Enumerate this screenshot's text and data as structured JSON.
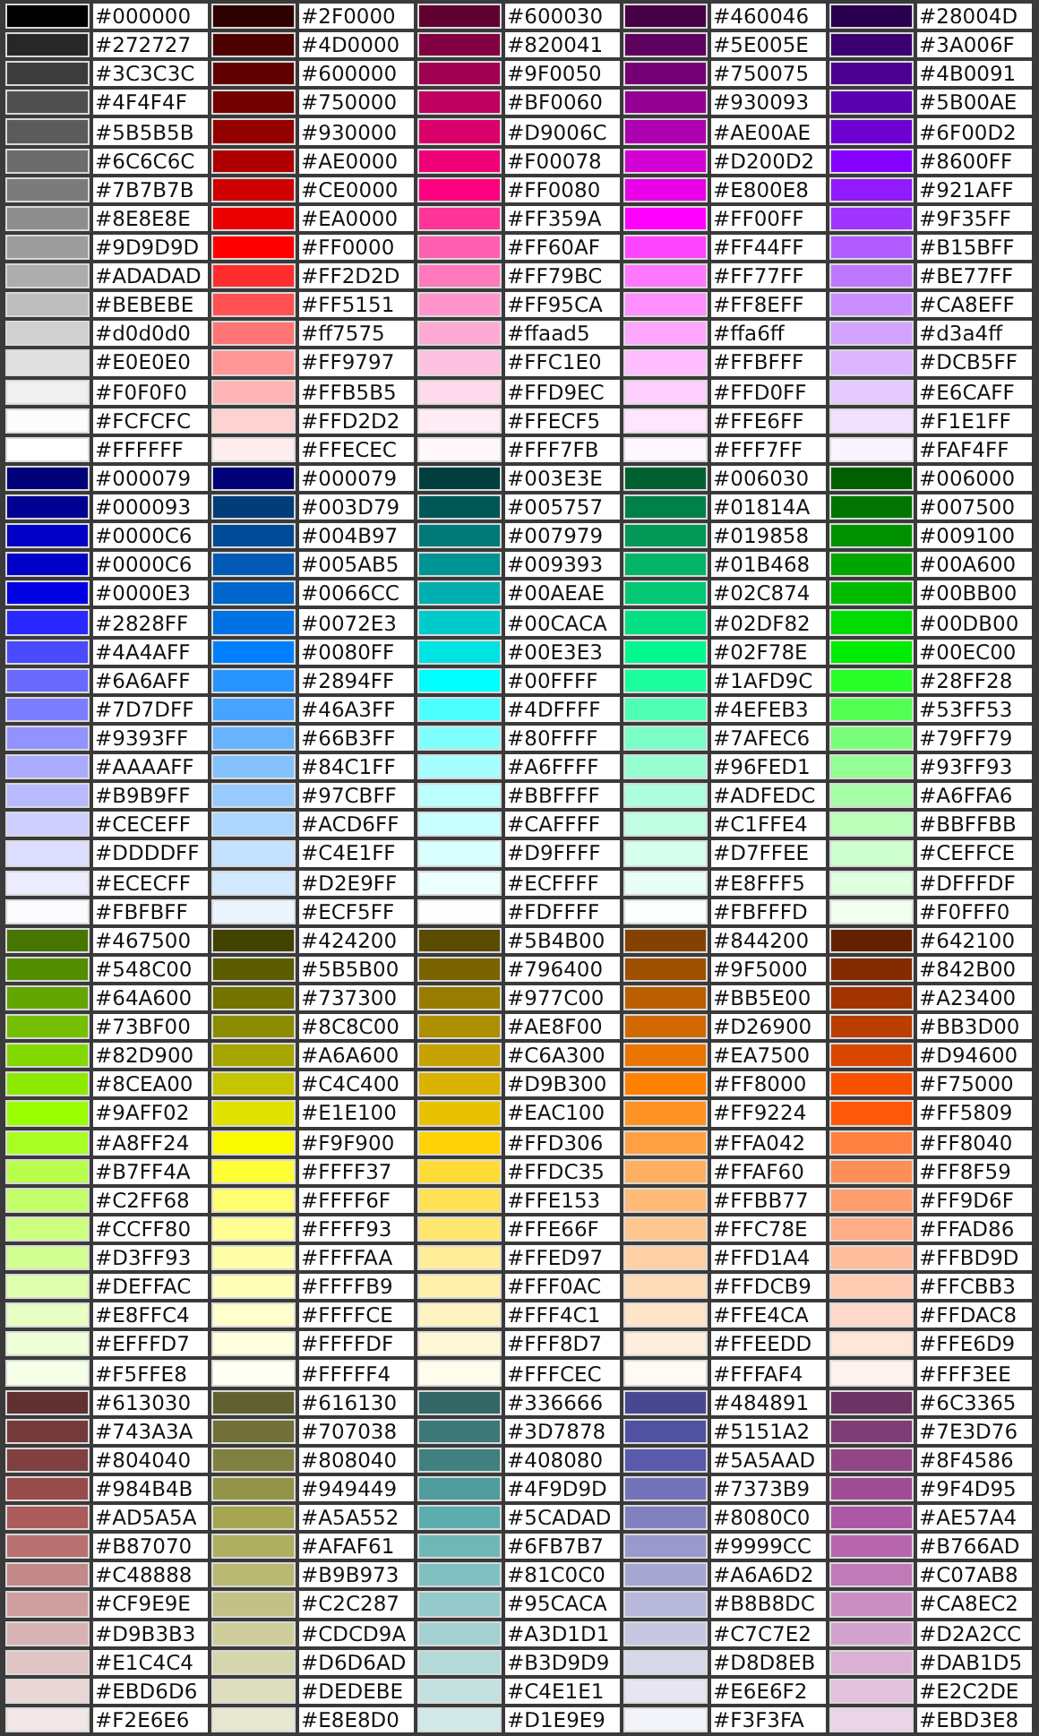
{
  "groups": [
    {
      "rows": [
        [
          {
            "code": "#000000",
            "color": "#000000"
          },
          {
            "code": "#2F0000",
            "color": "#2f0000"
          },
          {
            "code": "#600030",
            "color": "#600030"
          },
          {
            "code": "#460046",
            "color": "#460046"
          },
          {
            "code": "#28004D",
            "color": "#28004d"
          }
        ],
        [
          {
            "code": "#272727",
            "color": "#272727"
          },
          {
            "code": "#4D0000",
            "color": "#4d0000"
          },
          {
            "code": "#820041",
            "color": "#820041"
          },
          {
            "code": "#5E005E",
            "color": "#5e005e"
          },
          {
            "code": "#3A006F",
            "color": "#3a006f"
          }
        ],
        [
          {
            "code": "#3C3C3C",
            "color": "#3c3c3c"
          },
          {
            "code": "#600000",
            "color": "#600000"
          },
          {
            "code": "#9F0050",
            "color": "#9f0050"
          },
          {
            "code": "#750075",
            "color": "#750075"
          },
          {
            "code": "#4B0091",
            "color": "#4b0091"
          }
        ],
        [
          {
            "code": "#4F4F4F",
            "color": "#4f4f4f"
          },
          {
            "code": "#750000",
            "color": "#750000"
          },
          {
            "code": "#BF0060",
            "color": "#bf0060"
          },
          {
            "code": "#930093",
            "color": "#930093"
          },
          {
            "code": "#5B00AE",
            "color": "#5b00ae"
          }
        ],
        [
          {
            "code": "#5B5B5B",
            "color": "#5b5b5b"
          },
          {
            "code": "#930000",
            "color": "#930000"
          },
          {
            "code": "#D9006C",
            "color": "#d9006c"
          },
          {
            "code": "#AE00AE",
            "color": "#ae00ae"
          },
          {
            "code": "#6F00D2",
            "color": "#6f00d2"
          }
        ],
        [
          {
            "code": "#6C6C6C",
            "color": "#6c6c6c"
          },
          {
            "code": "#AE0000",
            "color": "#ae0000"
          },
          {
            "code": "#F00078",
            "color": "#f00078"
          },
          {
            "code": "#D200D2",
            "color": "#d200d2"
          },
          {
            "code": "#8600FF",
            "color": "#8600ff"
          }
        ],
        [
          {
            "code": "#7B7B7B",
            "color": "#7b7b7b"
          },
          {
            "code": "#CE0000",
            "color": "#ce0000"
          },
          {
            "code": "#FF0080",
            "color": "#ff0080"
          },
          {
            "code": "#E800E8",
            "color": "#e800e8"
          },
          {
            "code": "#921AFF",
            "color": "#921aff"
          }
        ],
        [
          {
            "code": "#8E8E8E",
            "color": "#8e8e8e"
          },
          {
            "code": "#EA0000",
            "color": "#ea0000"
          },
          {
            "code": "#FF359A",
            "color": "#ff359a"
          },
          {
            "code": "#FF00FF",
            "color": "#ff00ff"
          },
          {
            "code": "#9F35FF",
            "color": "#9f35ff"
          }
        ],
        [
          {
            "code": "#9D9D9D",
            "color": "#9d9d9d"
          },
          {
            "code": "#FF0000",
            "color": "#ff0000"
          },
          {
            "code": "#FF60AF",
            "color": "#ff60af"
          },
          {
            "code": "#FF44FF",
            "color": "#ff44ff"
          },
          {
            "code": "#B15BFF",
            "color": "#b15bff"
          }
        ],
        [
          {
            "code": "#ADADAD",
            "color": "#adadad"
          },
          {
            "code": "#FF2D2D",
            "color": "#ff2d2d"
          },
          {
            "code": "#FF79BC",
            "color": "#ff79bc"
          },
          {
            "code": "#FF77FF",
            "color": "#ff77ff"
          },
          {
            "code": "#BE77FF",
            "color": "#be77ff"
          }
        ],
        [
          {
            "code": "#BEBEBE",
            "color": "#bebebe"
          },
          {
            "code": "#FF5151",
            "color": "#ff5151"
          },
          {
            "code": "#FF95CA",
            "color": "#ff95ca"
          },
          {
            "code": "#FF8EFF",
            "color": "#ff8eff"
          },
          {
            "code": "#CA8EFF",
            "color": "#ca8eff"
          }
        ],
        [
          {
            "code": "#d0d0d0",
            "color": "#d0d0d0"
          },
          {
            "code": "#ff7575",
            "color": "#ff7575"
          },
          {
            "code": "#ffaad5",
            "color": "#ffaad5"
          },
          {
            "code": "#ffa6ff",
            "color": "#ffa6ff"
          },
          {
            "code": "#d3a4ff",
            "color": "#d3a4ff"
          }
        ],
        [
          {
            "code": "#E0E0E0",
            "color": "#e0e0e0"
          },
          {
            "code": "#FF9797",
            "color": "#ff9797"
          },
          {
            "code": "#FFC1E0",
            "color": "#ffc1e0"
          },
          {
            "code": "#FFBFFF",
            "color": "#ffbfff"
          },
          {
            "code": "#DCB5FF",
            "color": "#dcb5ff"
          }
        ],
        [
          {
            "code": "#F0F0F0",
            "color": "#f0f0f0"
          },
          {
            "code": "#FFB5B5",
            "color": "#ffb5b5"
          },
          {
            "code": "#FFD9EC",
            "color": "#ffd9ec"
          },
          {
            "code": "#FFD0FF",
            "color": "#ffd0ff"
          },
          {
            "code": "#E6CAFF",
            "color": "#e6caff"
          }
        ],
        [
          {
            "code": "#FCFCFC",
            "color": "#fcfcfc"
          },
          {
            "code": "#FFD2D2",
            "color": "#ffd2d2"
          },
          {
            "code": "#FFECF5",
            "color": "#ffecf5"
          },
          {
            "code": "#FFE6FF",
            "color": "#ffe6ff"
          },
          {
            "code": "#F1E1FF",
            "color": "#f1e1ff"
          }
        ],
        [
          {
            "code": "#FFFFFF",
            "color": "#ffffff"
          },
          {
            "code": "#FFECEC",
            "color": "#ffecec"
          },
          {
            "code": "#FFF7FB",
            "color": "#fff7fb"
          },
          {
            "code": "#FFF7FF",
            "color": "#fff7ff"
          },
          {
            "code": "#FAF4FF",
            "color": "#faf4ff"
          }
        ]
      ]
    },
    {
      "rows": [
        [
          {
            "code": "#000079",
            "color": "#000079"
          },
          {
            "code": "#000079",
            "color": "#000079"
          },
          {
            "code": "#003E3E",
            "color": "#003e3e"
          },
          {
            "code": "#006030",
            "color": "#006030"
          },
          {
            "code": "#006000",
            "color": "#006000"
          }
        ],
        [
          {
            "code": "#000093",
            "color": "#000093"
          },
          {
            "code": "#003D79",
            "color": "#003d79"
          },
          {
            "code": "#005757",
            "color": "#005757"
          },
          {
            "code": "#01814A",
            "color": "#01814a"
          },
          {
            "code": "#007500",
            "color": "#007500"
          }
        ],
        [
          {
            "code": "#0000C6",
            "color": "#0000c6"
          },
          {
            "code": "#004B97",
            "color": "#004b97"
          },
          {
            "code": "#007979",
            "color": "#007979"
          },
          {
            "code": "#019858",
            "color": "#019858"
          },
          {
            "code": "#009100",
            "color": "#009100"
          }
        ],
        [
          {
            "code": "#0000C6",
            "color": "#0000c6"
          },
          {
            "code": "#005AB5",
            "color": "#005ab5"
          },
          {
            "code": "#009393",
            "color": "#009393"
          },
          {
            "code": "#01B468",
            "color": "#01b468"
          },
          {
            "code": "#00A600",
            "color": "#00a600"
          }
        ],
        [
          {
            "code": "#0000E3",
            "color": "#0000e3"
          },
          {
            "code": "#0066CC",
            "color": "#0066cc"
          },
          {
            "code": "#00AEAE",
            "color": "#00aeae"
          },
          {
            "code": "#02C874",
            "color": "#02c874"
          },
          {
            "code": "#00BB00",
            "color": "#00bb00"
          }
        ],
        [
          {
            "code": "#2828FF",
            "color": "#2828ff"
          },
          {
            "code": "#0072E3",
            "color": "#0072e3"
          },
          {
            "code": "#00CACA",
            "color": "#00caca"
          },
          {
            "code": "#02DF82",
            "color": "#02df82"
          },
          {
            "code": "#00DB00",
            "color": "#00db00"
          }
        ],
        [
          {
            "code": "#4A4AFF",
            "color": "#4a4aff"
          },
          {
            "code": "#0080FF",
            "color": "#0080ff"
          },
          {
            "code": "#00E3E3",
            "color": "#00e3e3"
          },
          {
            "code": "#02F78E",
            "color": "#02f78e"
          },
          {
            "code": "#00EC00",
            "color": "#00ec00"
          }
        ],
        [
          {
            "code": "#6A6AFF",
            "color": "#6a6aff"
          },
          {
            "code": "#2894FF",
            "color": "#2894ff"
          },
          {
            "code": "#00FFFF",
            "color": "#00ffff"
          },
          {
            "code": "#1AFD9C",
            "color": "#1afd9c"
          },
          {
            "code": "#28FF28",
            "color": "#28ff28"
          }
        ],
        [
          {
            "code": "#7D7DFF",
            "color": "#7d7dff"
          },
          {
            "code": "#46A3FF",
            "color": "#46a3ff"
          },
          {
            "code": "#4DFFFF",
            "color": "#4dffff"
          },
          {
            "code": "#4EFEB3",
            "color": "#4efeb3"
          },
          {
            "code": "#53FF53",
            "color": "#53ff53"
          }
        ],
        [
          {
            "code": "#9393FF",
            "color": "#9393ff"
          },
          {
            "code": "#66B3FF",
            "color": "#66b3ff"
          },
          {
            "code": "#80FFFF",
            "color": "#80ffff"
          },
          {
            "code": "#7AFEC6",
            "color": "#7afec6"
          },
          {
            "code": "#79FF79",
            "color": "#79ff79"
          }
        ],
        [
          {
            "code": "#AAAAFF",
            "color": "#aaaaff"
          },
          {
            "code": "#84C1FF",
            "color": "#84c1ff"
          },
          {
            "code": "#A6FFFF",
            "color": "#a6ffff"
          },
          {
            "code": "#96FED1",
            "color": "#96fed1"
          },
          {
            "code": "#93FF93",
            "color": "#93ff93"
          }
        ],
        [
          {
            "code": "#B9B9FF",
            "color": "#b9b9ff"
          },
          {
            "code": "#97CBFF",
            "color": "#97cbff"
          },
          {
            "code": "#BBFFFF",
            "color": "#bbffff"
          },
          {
            "code": "#ADFEDC",
            "color": "#adfedc"
          },
          {
            "code": "#A6FFA6",
            "color": "#a6ffa6"
          }
        ],
        [
          {
            "code": "#CECEFF",
            "color": "#ceceff"
          },
          {
            "code": "#ACD6FF",
            "color": "#acd6ff"
          },
          {
            "code": "#CAFFFF",
            "color": "#caffff"
          },
          {
            "code": "#C1FFE4",
            "color": "#c1ffe4"
          },
          {
            "code": "#BBFFBB",
            "color": "#bbffbb"
          }
        ],
        [
          {
            "code": "#DDDDFF",
            "color": "#ddddff"
          },
          {
            "code": "#C4E1FF",
            "color": "#c4e1ff"
          },
          {
            "code": "#D9FFFF",
            "color": "#d9ffff"
          },
          {
            "code": "#D7FFEE",
            "color": "#d7ffee"
          },
          {
            "code": "#CEFFCE",
            "color": "#ceffce"
          }
        ],
        [
          {
            "code": "#ECECFF",
            "color": "#ececff"
          },
          {
            "code": "#D2E9FF",
            "color": "#d2e9ff"
          },
          {
            "code": "#ECFFFF",
            "color": "#ecffff"
          },
          {
            "code": "#E8FFF5",
            "color": "#e8fff5"
          },
          {
            "code": "#DFFFDF",
            "color": "#dfffdf"
          }
        ],
        [
          {
            "code": "#FBFBFF",
            "color": "#fbfbff"
          },
          {
            "code": "#ECF5FF",
            "color": "#ecf5ff"
          },
          {
            "code": "#FDFFFF",
            "color": "#fdffff"
          },
          {
            "code": "#FBFFFD",
            "color": "#fbfffd"
          },
          {
            "code": "#F0FFF0",
            "color": "#f0fff0"
          }
        ]
      ]
    },
    {
      "rows": [
        [
          {
            "code": "#467500",
            "color": "#467500"
          },
          {
            "code": "#424200",
            "color": "#424200"
          },
          {
            "code": "#5B4B00",
            "color": "#5b4b00"
          },
          {
            "code": "#844200",
            "color": "#844200"
          },
          {
            "code": "#642100",
            "color": "#642100"
          }
        ],
        [
          {
            "code": "#548C00",
            "color": "#548c00"
          },
          {
            "code": "#5B5B00",
            "color": "#5b5b00"
          },
          {
            "code": "#796400",
            "color": "#796400"
          },
          {
            "code": "#9F5000",
            "color": "#9f5000"
          },
          {
            "code": "#842B00",
            "color": "#842b00"
          }
        ],
        [
          {
            "code": "#64A600",
            "color": "#64a600"
          },
          {
            "code": "#737300",
            "color": "#737300"
          },
          {
            "code": "#977C00",
            "color": "#977c00"
          },
          {
            "code": "#BB5E00",
            "color": "#bb5e00"
          },
          {
            "code": "#A23400",
            "color": "#a23400"
          }
        ],
        [
          {
            "code": "#73BF00",
            "color": "#73bf00"
          },
          {
            "code": "#8C8C00",
            "color": "#8c8c00"
          },
          {
            "code": "#AE8F00",
            "color": "#ae8f00"
          },
          {
            "code": "#D26900",
            "color": "#d26900"
          },
          {
            "code": "#BB3D00",
            "color": "#bb3d00"
          }
        ],
        [
          {
            "code": "#82D900",
            "color": "#82d900"
          },
          {
            "code": "#A6A600",
            "color": "#a6a600"
          },
          {
            "code": "#C6A300",
            "color": "#c6a300"
          },
          {
            "code": "#EA7500",
            "color": "#ea7500"
          },
          {
            "code": "#D94600",
            "color": "#d94600"
          }
        ],
        [
          {
            "code": "#8CEA00",
            "color": "#8cea00"
          },
          {
            "code": "#C4C400",
            "color": "#c4c400"
          },
          {
            "code": "#D9B300",
            "color": "#d9b300"
          },
          {
            "code": "#FF8000",
            "color": "#ff8000"
          },
          {
            "code": "#F75000",
            "color": "#f75000"
          }
        ],
        [
          {
            "code": "#9AFF02",
            "color": "#9aff02"
          },
          {
            "code": "#E1E100",
            "color": "#e1e100"
          },
          {
            "code": "#EAC100",
            "color": "#eac100"
          },
          {
            "code": "#FF9224",
            "color": "#ff9224"
          },
          {
            "code": "#FF5809",
            "color": "#ff5809"
          }
        ],
        [
          {
            "code": "#A8FF24",
            "color": "#a8ff24"
          },
          {
            "code": "#F9F900",
            "color": "#f9f900"
          },
          {
            "code": "#FFD306",
            "color": "#ffd306"
          },
          {
            "code": "#FFA042",
            "color": "#ffa042"
          },
          {
            "code": "#FF8040",
            "color": "#ff8040"
          }
        ],
        [
          {
            "code": "#B7FF4A",
            "color": "#b7ff4a"
          },
          {
            "code": "#FFFF37",
            "color": "#ffff37"
          },
          {
            "code": "#FFDC35",
            "color": "#ffdc35"
          },
          {
            "code": "#FFAF60",
            "color": "#ffaf60"
          },
          {
            "code": "#FF8F59",
            "color": "#ff8f59"
          }
        ],
        [
          {
            "code": "#C2FF68",
            "color": "#c2ff68"
          },
          {
            "code": "#FFFF6F",
            "color": "#ffff6f"
          },
          {
            "code": "#FFE153",
            "color": "#ffe153"
          },
          {
            "code": "#FFBB77",
            "color": "#ffbb77"
          },
          {
            "code": "#FF9D6F",
            "color": "#ff9d6f"
          }
        ],
        [
          {
            "code": "#CCFF80",
            "color": "#ccff80"
          },
          {
            "code": "#FFFF93",
            "color": "#ffff93"
          },
          {
            "code": "#FFE66F",
            "color": "#ffe66f"
          },
          {
            "code": "#FFC78E",
            "color": "#ffc78e"
          },
          {
            "code": "#FFAD86",
            "color": "#ffad86"
          }
        ],
        [
          {
            "code": "#D3FF93",
            "color": "#d3ff93"
          },
          {
            "code": "#FFFFAA",
            "color": "#ffffaa"
          },
          {
            "code": "#FFED97",
            "color": "#ffed97"
          },
          {
            "code": "#FFD1A4",
            "color": "#ffd1a4"
          },
          {
            "code": "#FFBD9D",
            "color": "#ffbd9d"
          }
        ],
        [
          {
            "code": "#DEFFAC",
            "color": "#deffac"
          },
          {
            "code": "#FFFFB9",
            "color": "#ffffb9"
          },
          {
            "code": "#FFF0AC",
            "color": "#fff0ac"
          },
          {
            "code": "#FFDCB9",
            "color": "#ffdcb9"
          },
          {
            "code": "#FFCBB3",
            "color": "#ffcbb3"
          }
        ],
        [
          {
            "code": "#E8FFC4",
            "color": "#e8ffc4"
          },
          {
            "code": "#FFFFCE",
            "color": "#ffffce"
          },
          {
            "code": "#FFF4C1",
            "color": "#fff4c1"
          },
          {
            "code": "#FFE4CA",
            "color": "#ffe4ca"
          },
          {
            "code": "#FFDAC8",
            "color": "#ffdac8"
          }
        ],
        [
          {
            "code": "#EFFFD7",
            "color": "#efffd7"
          },
          {
            "code": "#FFFFDF",
            "color": "#ffffdf"
          },
          {
            "code": "#FFF8D7",
            "color": "#fff8d7"
          },
          {
            "code": "#FFEEDD",
            "color": "#ffeedd"
          },
          {
            "code": "#FFE6D9",
            "color": "#ffe6d9"
          }
        ],
        [
          {
            "code": "#F5FFE8",
            "color": "#f5ffe8"
          },
          {
            "code": "#FFFFF4",
            "color": "#fffff4"
          },
          {
            "code": "#FFFCEC",
            "color": "#fffcec"
          },
          {
            "code": "#FFFAF4",
            "color": "#fffaf4"
          },
          {
            "code": "#FFF3EE",
            "color": "#fff3ee"
          }
        ]
      ]
    },
    {
      "rows": [
        [
          {
            "code": "#613030",
            "color": "#613030"
          },
          {
            "code": "#616130",
            "color": "#616130"
          },
          {
            "code": "#336666",
            "color": "#336666"
          },
          {
            "code": "#484891",
            "color": "#484891"
          },
          {
            "code": "#6C3365",
            "color": "#6c3365"
          }
        ],
        [
          {
            "code": "#743A3A",
            "color": "#743a3a"
          },
          {
            "code": "#707038",
            "color": "#707038"
          },
          {
            "code": "#3D7878",
            "color": "#3d7878"
          },
          {
            "code": "#5151A2",
            "color": "#5151a2"
          },
          {
            "code": "#7E3D76",
            "color": "#7e3d76"
          }
        ],
        [
          {
            "code": "#804040",
            "color": "#804040"
          },
          {
            "code": "#808040",
            "color": "#808040"
          },
          {
            "code": "#408080",
            "color": "#408080"
          },
          {
            "code": "#5A5AAD",
            "color": "#5a5aad"
          },
          {
            "code": "#8F4586",
            "color": "#8f4586"
          }
        ],
        [
          {
            "code": "#984B4B",
            "color": "#984b4b"
          },
          {
            "code": "#949449",
            "color": "#949449"
          },
          {
            "code": "#4F9D9D",
            "color": "#4f9d9d"
          },
          {
            "code": "#7373B9",
            "color": "#7373b9"
          },
          {
            "code": "#9F4D95",
            "color": "#9f4d95"
          }
        ],
        [
          {
            "code": "#AD5A5A",
            "color": "#ad5a5a"
          },
          {
            "code": "#A5A552",
            "color": "#a5a552"
          },
          {
            "code": "#5CADAD",
            "color": "#5cadad"
          },
          {
            "code": "#8080C0",
            "color": "#8080c0"
          },
          {
            "code": "#AE57A4",
            "color": "#ae57a4"
          }
        ],
        [
          {
            "code": "#B87070",
            "color": "#b87070"
          },
          {
            "code": "#AFAF61",
            "color": "#afaf61"
          },
          {
            "code": "#6FB7B7",
            "color": "#6fb7b7"
          },
          {
            "code": "#9999CC",
            "color": "#9999cc"
          },
          {
            "code": "#B766AD",
            "color": "#b766ad"
          }
        ],
        [
          {
            "code": "#C48888",
            "color": "#c48888"
          },
          {
            "code": "#B9B973",
            "color": "#b9b973"
          },
          {
            "code": "#81C0C0",
            "color": "#81c0c0"
          },
          {
            "code": "#A6A6D2",
            "color": "#a6a6d2"
          },
          {
            "code": "#C07AB8",
            "color": "#c07ab8"
          }
        ],
        [
          {
            "code": "#CF9E9E",
            "color": "#cf9e9e"
          },
          {
            "code": "#C2C287",
            "color": "#c2c287"
          },
          {
            "code": "#95CACA",
            "color": "#95caca"
          },
          {
            "code": "#B8B8DC",
            "color": "#b8b8dc"
          },
          {
            "code": "#CA8EC2",
            "color": "#ca8ec2"
          }
        ],
        [
          {
            "code": "#D9B3B3",
            "color": "#d9b3b3"
          },
          {
            "code": "#CDCD9A",
            "color": "#cdcd9a"
          },
          {
            "code": "#A3D1D1",
            "color": "#a3d1d1"
          },
          {
            "code": "#C7C7E2",
            "color": "#c7c7e2"
          },
          {
            "code": "#D2A2CC",
            "color": "#d2a2cc"
          }
        ],
        [
          {
            "code": "#E1C4C4",
            "color": "#e1c4c4"
          },
          {
            "code": "#D6D6AD",
            "color": "#d6d6ad"
          },
          {
            "code": "#B3D9D9",
            "color": "#b3d9d9"
          },
          {
            "code": "#D8D8EB",
            "color": "#d8d8eb"
          },
          {
            "code": "#DAB1D5",
            "color": "#dab1d5"
          }
        ],
        [
          {
            "code": "#EBD6D6",
            "color": "#ebd6d6"
          },
          {
            "code": "#DEDEBE",
            "color": "#dedebe"
          },
          {
            "code": "#C4E1E1",
            "color": "#c4e1e1"
          },
          {
            "code": "#E6E6F2",
            "color": "#e6e6f2"
          },
          {
            "code": "#E2C2DE",
            "color": "#e2c2de"
          }
        ],
        [
          {
            "code": "#F2E6E6",
            "color": "#f2e6e6"
          },
          {
            "code": "#E8E8D0",
            "color": "#e8e8d0"
          },
          {
            "code": "#D1E9E9",
            "color": "#d1e9e9"
          },
          {
            "code": "#F3F3FA",
            "color": "#f3f3fa"
          },
          {
            "code": "#EBD3E8",
            "color": "#ebd3e8"
          }
        ]
      ]
    }
  ]
}
